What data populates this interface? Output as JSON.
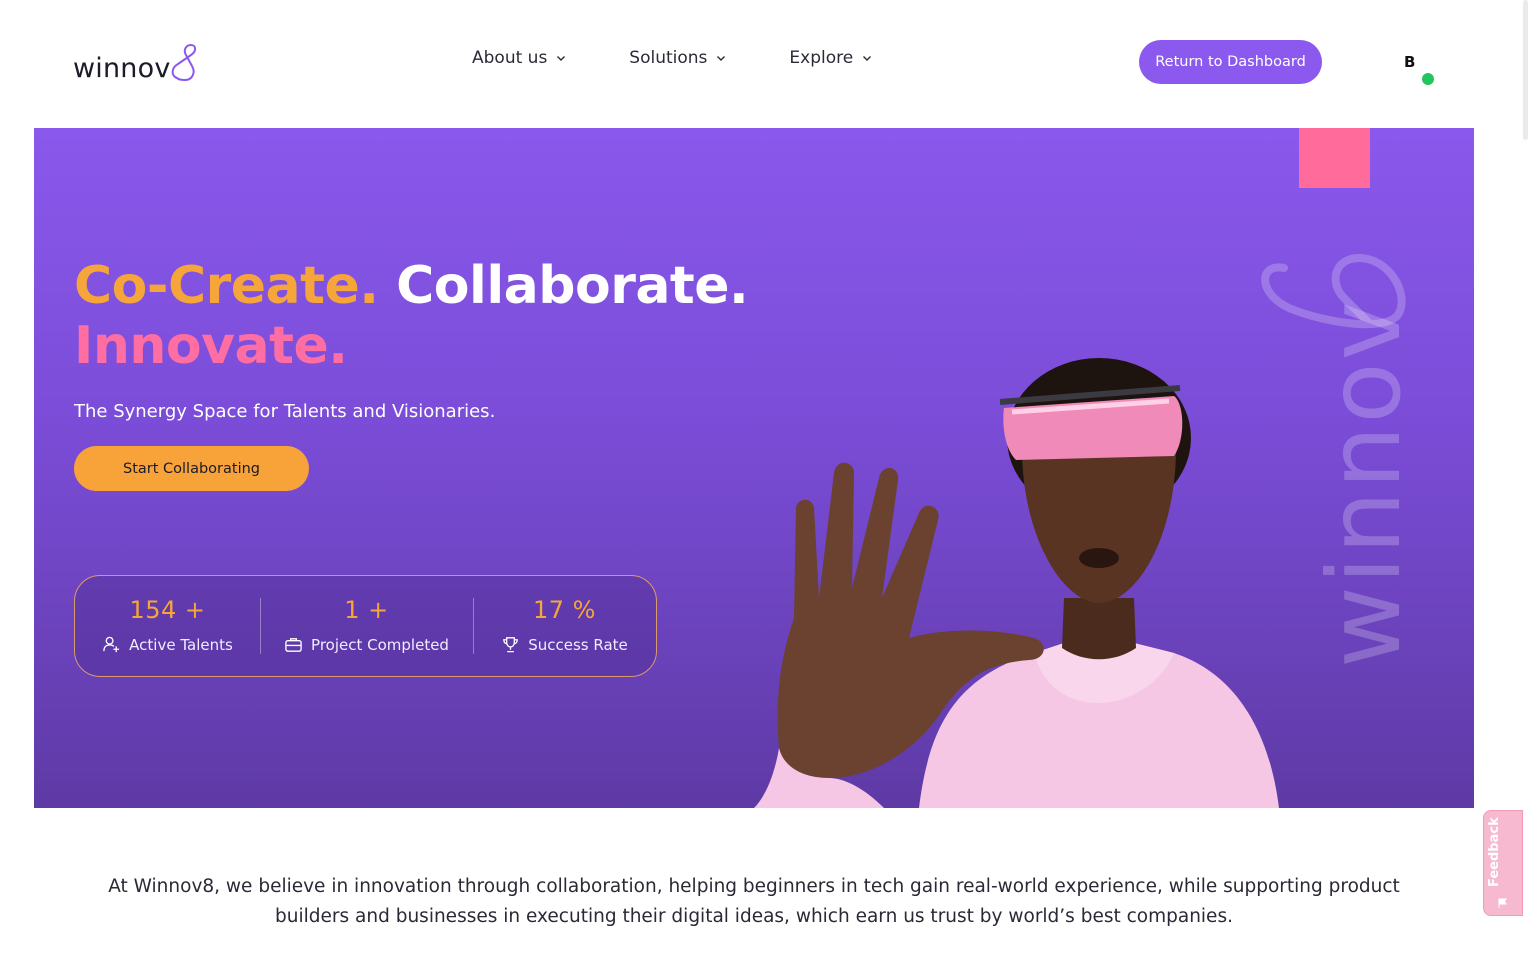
{
  "header": {
    "logo_text": "winnov",
    "logo_mark": "8",
    "nav": [
      {
        "label": "About us",
        "icon": "chevron-down-icon"
      },
      {
        "label": "Solutions",
        "icon": "chevron-down-icon"
      },
      {
        "label": "Explore",
        "icon": "chevron-down-icon"
      }
    ],
    "dashboard_button": "Return to Dashboard",
    "avatar_initial": "B",
    "avatar_status_color": "#22c55e"
  },
  "hero": {
    "title_part1": "Co-Create.",
    "title_part2": "Collaborate.",
    "title_part3": "Innovate.",
    "subtitle": "The Synergy Space for Talents and Visionaries.",
    "cta": "Start Collaborating",
    "stats": [
      {
        "value": "154 +",
        "label": "Active Talents",
        "icon": "user-plus-icon"
      },
      {
        "value": "1 +",
        "label": "Project Completed",
        "icon": "briefcase-icon"
      },
      {
        "value": "17 %",
        "label": "Success Rate",
        "icon": "trophy-icon"
      }
    ],
    "watermark": "winnov8",
    "colors": {
      "purple": "#8a58ec",
      "orange": "#f5a53a",
      "pink": "#ff6ea2"
    }
  },
  "about": {
    "text": "At Winnov8, we believe in innovation through collaboration, helping beginners in tech gain real-world experience, while supporting product builders and businesses in executing their digital ideas, which earn us trust by world’s best companies."
  },
  "feedback": {
    "label": "Feedback",
    "icon": "flag-icon"
  }
}
